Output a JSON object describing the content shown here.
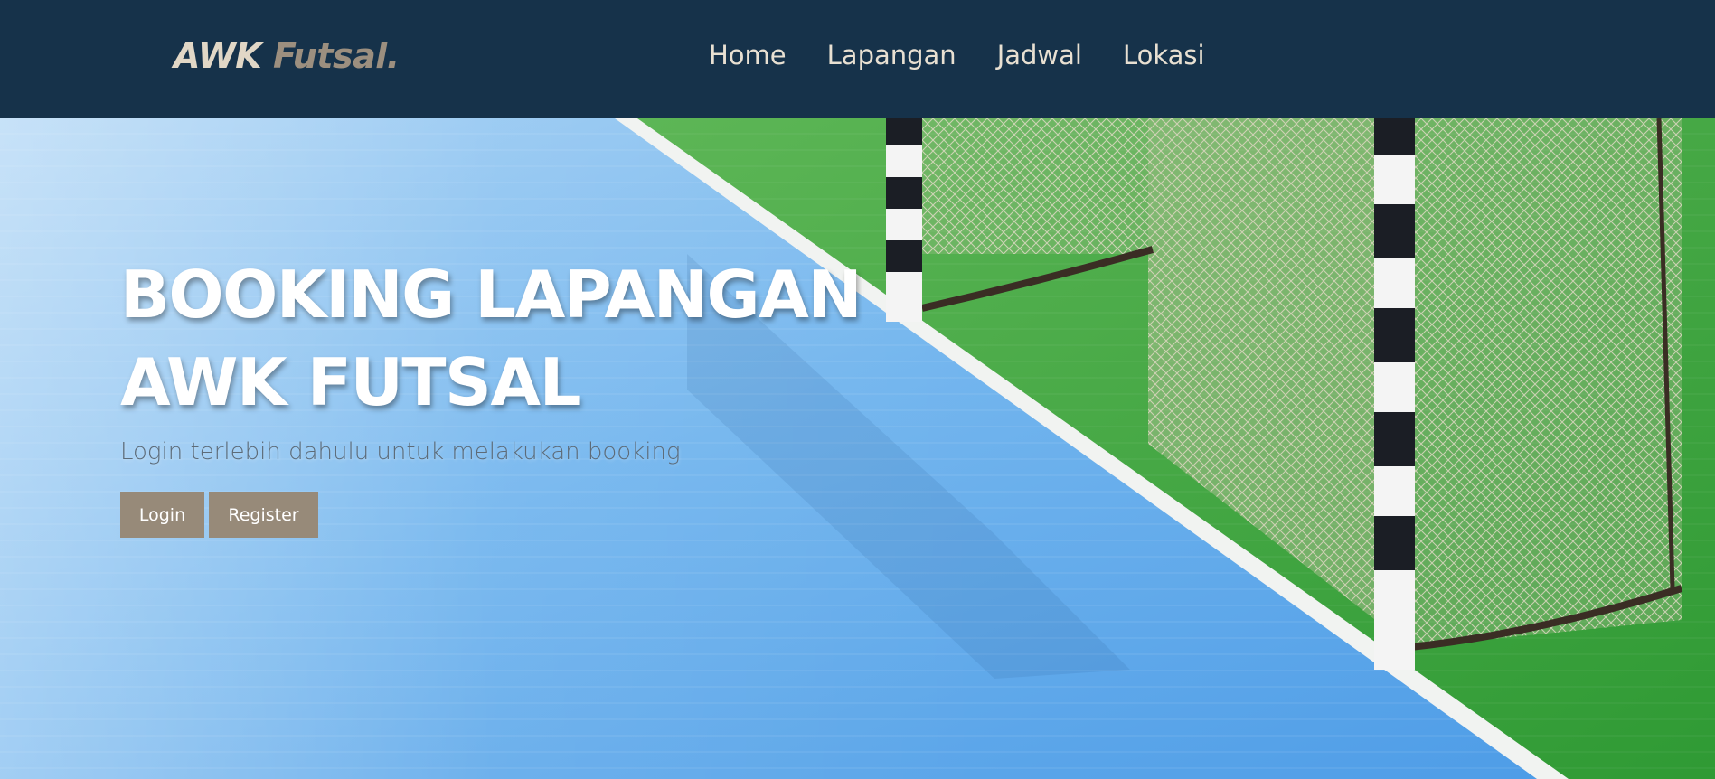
{
  "navbar": {
    "brand_part1": "AWK",
    "brand_part2": "Futsal.",
    "links": [
      "Home",
      "Lapangan",
      "Jadwal",
      "Lokasi"
    ]
  },
  "hero": {
    "title_line1": "BOOKING LAPANGAN",
    "title_line2": "AWK FUTSAL",
    "subtitle": "Login terlebih dahulu untuk melakukan booking",
    "login_label": "Login",
    "register_label": "Register",
    "background_image": "futsal-court-goal-photo"
  },
  "colors": {
    "navbar_bg": "#16324a",
    "brand_light": "#e1d7c6",
    "brand_dark": "#9c8f7f",
    "button_bg": "#978a79",
    "court_blue": "#6fb2ec",
    "court_green": "#3fa53d"
  }
}
